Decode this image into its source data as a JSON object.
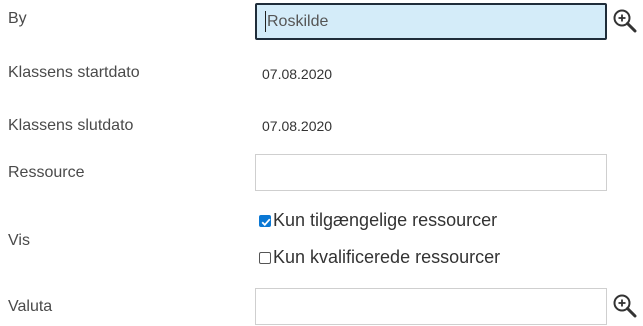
{
  "form": {
    "by": {
      "label": "By",
      "value": "Roskilde"
    },
    "startdato": {
      "label": "Klassens startdato",
      "value": "07.08.2020"
    },
    "slutdato": {
      "label": "Klassens slutdato",
      "value": "07.08.2020"
    },
    "ressource": {
      "label": "Ressource",
      "value": ""
    },
    "vis": {
      "label": "Vis",
      "options": [
        {
          "label": "Kun tilgængelige ressourcer",
          "checked": true
        },
        {
          "label": "Kun kvalificerede ressourcer",
          "checked": false
        }
      ]
    },
    "valuta": {
      "label": "Valuta",
      "value": ""
    }
  },
  "icons": {
    "lookup": "zoom-in-icon"
  },
  "colors": {
    "focus_bg": "#d4ecf9",
    "focus_border": "#1f2d3a",
    "checkbox_accent": "#0b78d4"
  }
}
